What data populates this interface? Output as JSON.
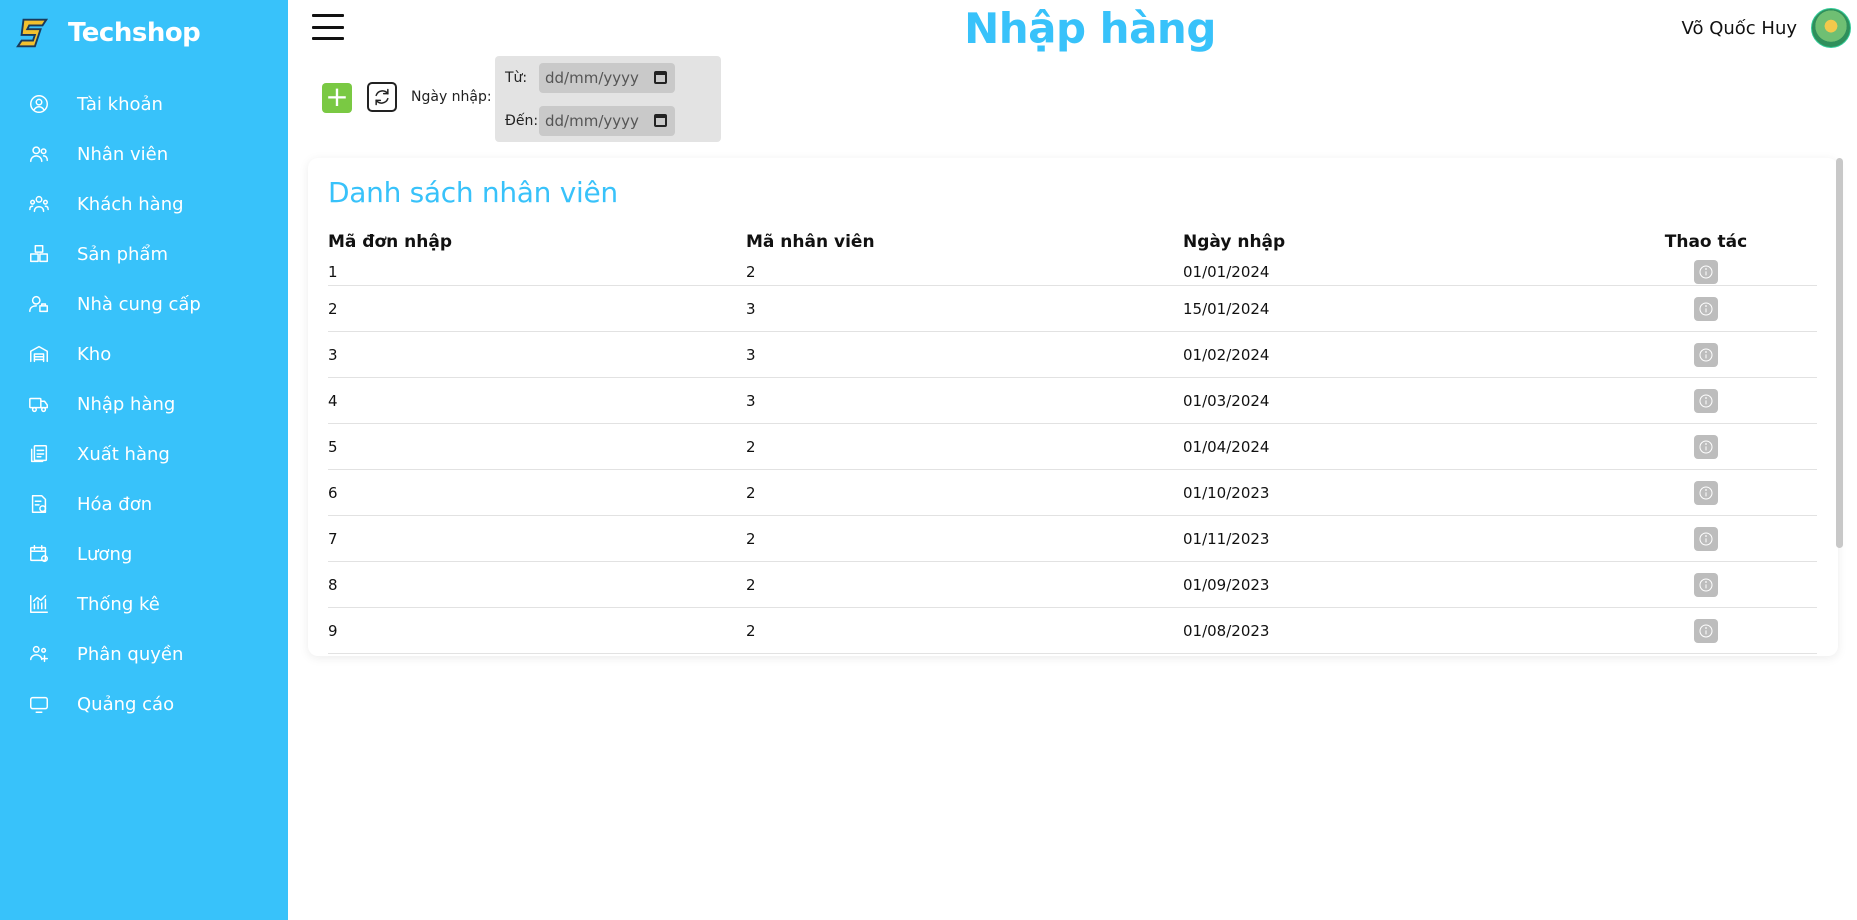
{
  "brand": {
    "name": "Techshop",
    "logo_icon": "lightning-s-logo-icon"
  },
  "colors": {
    "accent": "#38c2fa",
    "add_button": "#7ac943",
    "action_button": "#bdbdbd"
  },
  "sidebar": {
    "items": [
      {
        "label": "Tài khoản",
        "icon": "user-circle-icon"
      },
      {
        "label": "Nhân viên",
        "icon": "users-icon"
      },
      {
        "label": "Khách hàng",
        "icon": "customers-icon"
      },
      {
        "label": "Sản phẩm",
        "icon": "boxes-icon"
      },
      {
        "label": "Nhà cung cấp",
        "icon": "supplier-icon"
      },
      {
        "label": "Kho",
        "icon": "warehouse-icon"
      },
      {
        "label": "Nhập hàng",
        "icon": "truck-icon"
      },
      {
        "label": "Xuất hàng",
        "icon": "export-icon"
      },
      {
        "label": "Hóa đơn",
        "icon": "invoice-icon"
      },
      {
        "label": "Lương",
        "icon": "salary-icon"
      },
      {
        "label": "Thống kê",
        "icon": "chart-icon"
      },
      {
        "label": "Phân quyền",
        "icon": "permission-icon"
      },
      {
        "label": "Quảng cáo",
        "icon": "monitor-icon"
      }
    ]
  },
  "header": {
    "title": "Nhập hàng",
    "user_name": "Võ Quốc Huy"
  },
  "filter": {
    "date_label": "Ngày nhập:",
    "from_label": "Từ:",
    "to_label": "Đến:",
    "from_value": "dd/mm/yyyy",
    "to_value": "dd/mm/yyyy"
  },
  "table": {
    "title": "Danh sách nhân viên",
    "columns": [
      "Mã đơn nhập",
      "Mã nhân viên",
      "Ngày nhập",
      "Thao tác"
    ],
    "rows": [
      [
        "1",
        "2",
        "01/01/2024"
      ],
      [
        "2",
        "3",
        "15/01/2024"
      ],
      [
        "3",
        "3",
        "01/02/2024"
      ],
      [
        "4",
        "3",
        "01/03/2024"
      ],
      [
        "5",
        "2",
        "01/04/2024"
      ],
      [
        "6",
        "2",
        "01/10/2023"
      ],
      [
        "7",
        "2",
        "01/11/2023"
      ],
      [
        "8",
        "2",
        "01/09/2023"
      ],
      [
        "9",
        "2",
        "01/08/2023"
      ]
    ]
  }
}
